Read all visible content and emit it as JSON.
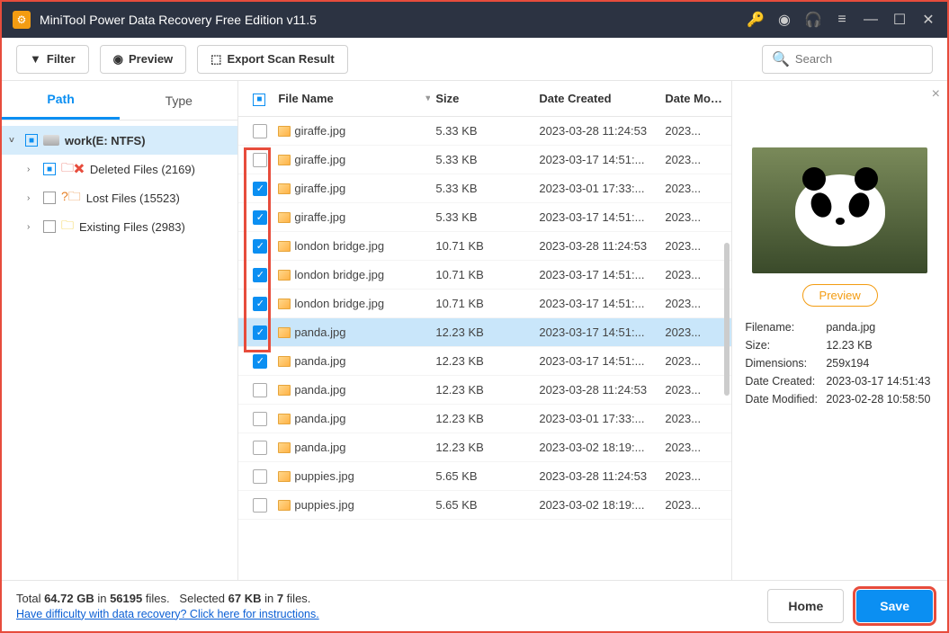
{
  "app": {
    "title": "MiniTool Power Data Recovery Free Edition v11.5"
  },
  "toolbar": {
    "filter_label": "Filter",
    "preview_label": "Preview",
    "export_label": "Export Scan Result",
    "search_placeholder": "Search"
  },
  "tabs": {
    "path": "Path",
    "type": "Type"
  },
  "tree": {
    "root": "work(E: NTFS)",
    "children": [
      {
        "label": "Deleted Files (2169)"
      },
      {
        "label": "Lost Files (15523)"
      },
      {
        "label": "Existing Files (2983)"
      }
    ]
  },
  "columns": {
    "name": "File Name",
    "size": "Size",
    "created": "Date Created",
    "modified": "Date Modif"
  },
  "files": [
    {
      "name": "giraffe.jpg",
      "size": "5.33 KB",
      "created": "2023-03-28 11:24:53",
      "modified": "2023...",
      "checked": false,
      "selected": false
    },
    {
      "name": "giraffe.jpg",
      "size": "5.33 KB",
      "created": "2023-03-17 14:51:...",
      "modified": "2023...",
      "checked": false,
      "selected": false
    },
    {
      "name": "giraffe.jpg",
      "size": "5.33 KB",
      "created": "2023-03-01 17:33:...",
      "modified": "2023...",
      "checked": true,
      "selected": false
    },
    {
      "name": "giraffe.jpg",
      "size": "5.33 KB",
      "created": "2023-03-17 14:51:...",
      "modified": "2023...",
      "checked": true,
      "selected": false
    },
    {
      "name": "london bridge.jpg",
      "size": "10.71 KB",
      "created": "2023-03-28 11:24:53",
      "modified": "2023...",
      "checked": true,
      "selected": false
    },
    {
      "name": "london bridge.jpg",
      "size": "10.71 KB",
      "created": "2023-03-17 14:51:...",
      "modified": "2023...",
      "checked": true,
      "selected": false
    },
    {
      "name": "london bridge.jpg",
      "size": "10.71 KB",
      "created": "2023-03-17 14:51:...",
      "modified": "2023...",
      "checked": true,
      "selected": false
    },
    {
      "name": "panda.jpg",
      "size": "12.23 KB",
      "created": "2023-03-17 14:51:...",
      "modified": "2023...",
      "checked": true,
      "selected": true
    },
    {
      "name": "panda.jpg",
      "size": "12.23 KB",
      "created": "2023-03-17 14:51:...",
      "modified": "2023...",
      "checked": true,
      "selected": false
    },
    {
      "name": "panda.jpg",
      "size": "12.23 KB",
      "created": "2023-03-28 11:24:53",
      "modified": "2023...",
      "checked": false,
      "selected": false
    },
    {
      "name": "panda.jpg",
      "size": "12.23 KB",
      "created": "2023-03-01 17:33:...",
      "modified": "2023...",
      "checked": false,
      "selected": false
    },
    {
      "name": "panda.jpg",
      "size": "12.23 KB",
      "created": "2023-03-02 18:19:...",
      "modified": "2023...",
      "checked": false,
      "selected": false
    },
    {
      "name": "puppies.jpg",
      "size": "5.65 KB",
      "created": "2023-03-28 11:24:53",
      "modified": "2023...",
      "checked": false,
      "selected": false
    },
    {
      "name": "puppies.jpg",
      "size": "5.65 KB",
      "created": "2023-03-02 18:19:...",
      "modified": "2023...",
      "checked": false,
      "selected": false
    }
  ],
  "preview": {
    "button": "Preview",
    "labels": {
      "filename": "Filename:",
      "size": "Size:",
      "dims": "Dimensions:",
      "created": "Date Created:",
      "modified": "Date Modified:"
    },
    "values": {
      "filename": "panda.jpg",
      "size": "12.23 KB",
      "dims": "259x194",
      "created": "2023-03-17 14:51:43",
      "modified": "2023-02-28 10:58:50"
    }
  },
  "footer": {
    "total_a": "Total ",
    "total_b": "64.72 GB",
    "total_c": " in ",
    "total_d": "56195",
    "total_e": " files.",
    "sel_a": "Selected ",
    "sel_b": "67 KB",
    "sel_c": " in ",
    "sel_d": "7",
    "sel_e": " files.",
    "help_link": "Have difficulty with data recovery? Click here for instructions.",
    "home": "Home",
    "save": "Save"
  }
}
